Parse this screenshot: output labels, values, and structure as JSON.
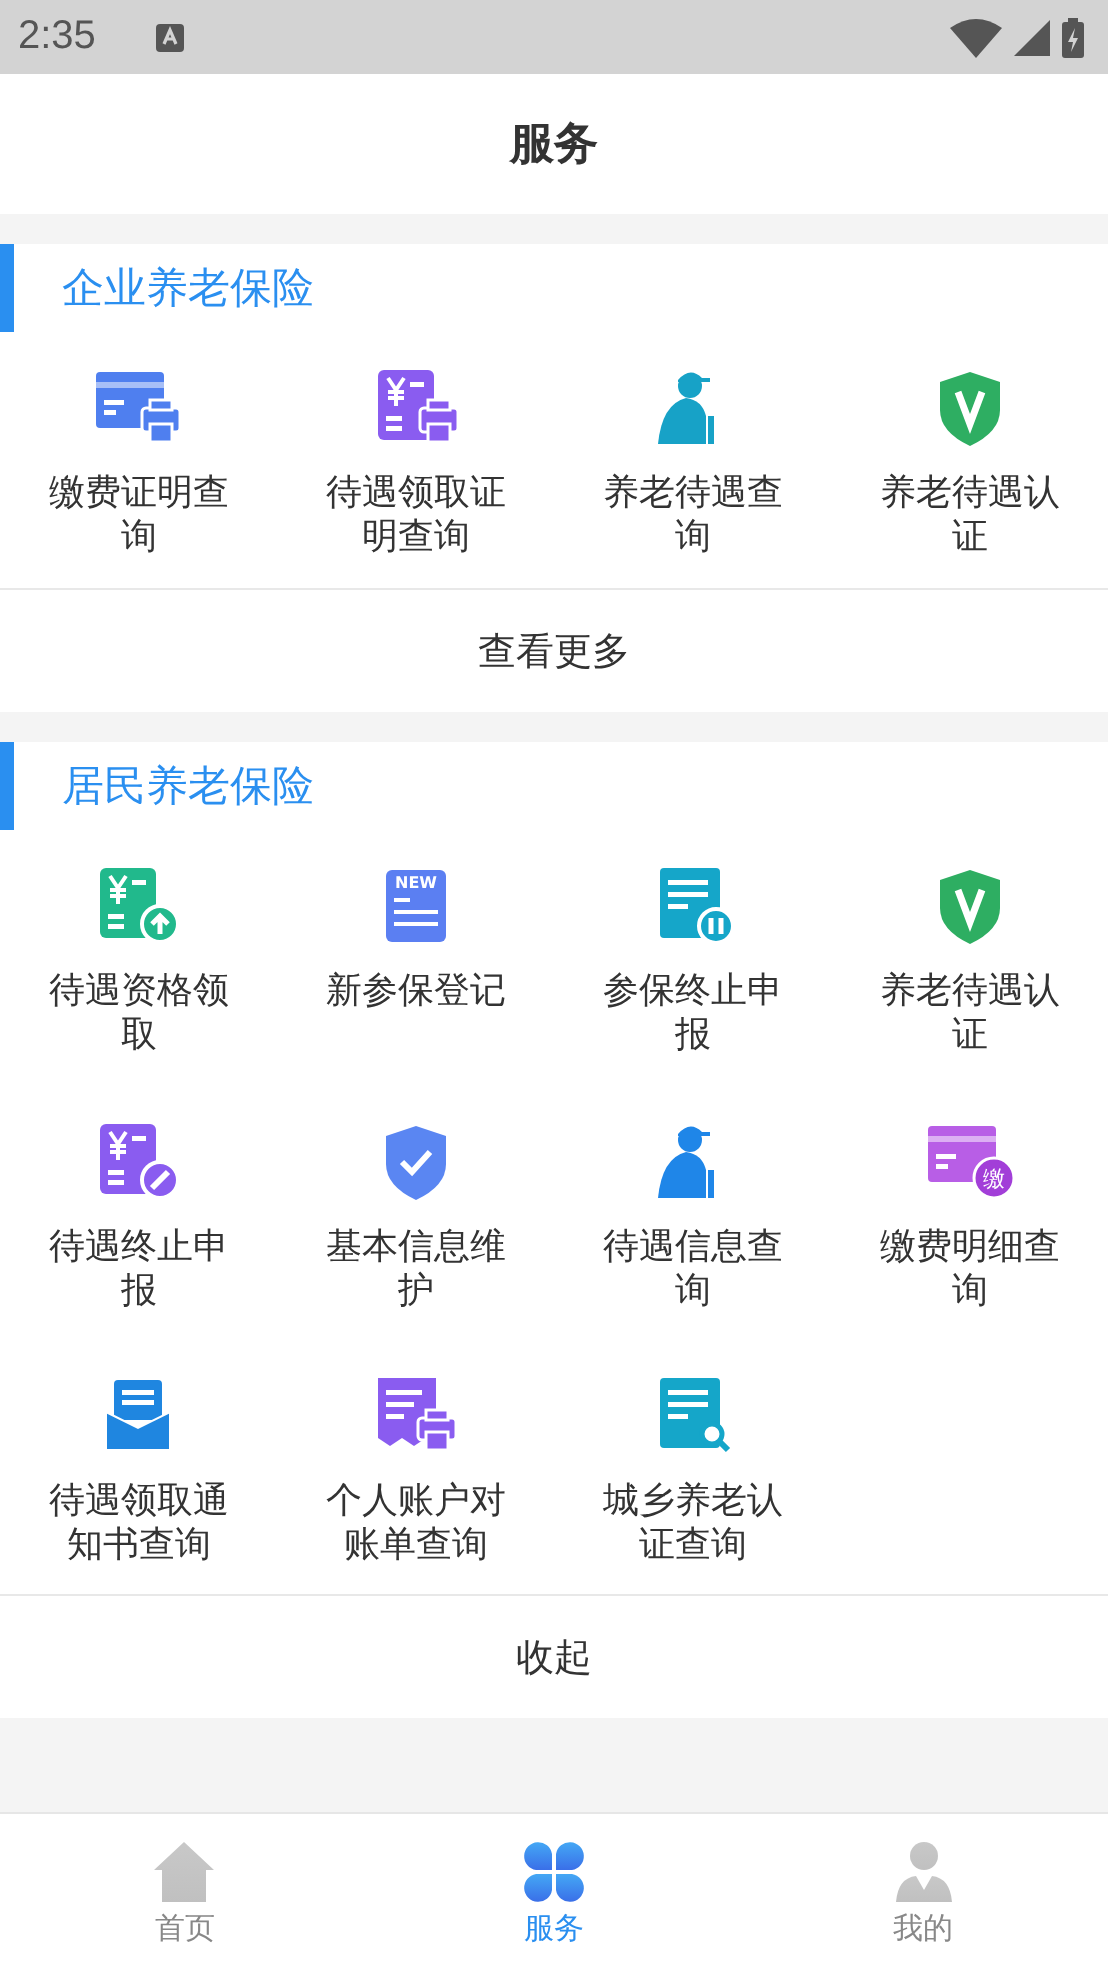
{
  "status_bar": {
    "time": "2:35"
  },
  "header": {
    "title": "服务"
  },
  "sections": [
    {
      "title": "企业养老保险",
      "items": [
        {
          "kind": "card-printer",
          "color": "#4f7fef",
          "label": "缴费证明查询"
        },
        {
          "kind": "receipt-printer",
          "color": "#8a5cf0",
          "label": "待遇领取证明查询"
        },
        {
          "kind": "elder",
          "color": "#17a2c7",
          "label": "养老待遇查询"
        },
        {
          "kind": "shield-v",
          "color": "#2eae62",
          "label": "养老待遇认证"
        }
      ],
      "footer": "查看更多"
    },
    {
      "title": "居民养老保险",
      "items": [
        {
          "kind": "receipt-up",
          "color": "#21b98c",
          "label": "待遇资格领取"
        },
        {
          "kind": "doc-new",
          "color": "#5b7ff2",
          "label": "新参保登记",
          "badge": "NEW"
        },
        {
          "kind": "doc-pause",
          "color": "#15a6c9",
          "label": "参保终止申报"
        },
        {
          "kind": "shield-v",
          "color": "#2eae62",
          "label": "养老待遇认证"
        },
        {
          "kind": "receipt-slash",
          "color": "#8a5cf0",
          "label": "待遇终止申报"
        },
        {
          "kind": "shield-check",
          "color": "#5a86f2",
          "label": "基本信息维护"
        },
        {
          "kind": "elder",
          "color": "#1f86e8",
          "label": "待遇信息查询"
        },
        {
          "kind": "card-badge",
          "color": "#b85ee6",
          "label": "缴费明细查询",
          "badge": "缴"
        },
        {
          "kind": "envelope",
          "color": "#1f86e0",
          "label": "待遇领取通知书查询"
        },
        {
          "kind": "bill-printer",
          "color": "#8a5cf0",
          "label": "个人账户对账单查询"
        },
        {
          "kind": "doc-search",
          "color": "#15a6c9",
          "label": "城乡养老认证查询"
        }
      ],
      "footer": "收起"
    }
  ],
  "tabs": [
    {
      "kind": "home",
      "label": "首页",
      "selected": false
    },
    {
      "kind": "clover",
      "label": "服务",
      "selected": true
    },
    {
      "kind": "person",
      "label": "我的",
      "selected": false
    }
  ]
}
